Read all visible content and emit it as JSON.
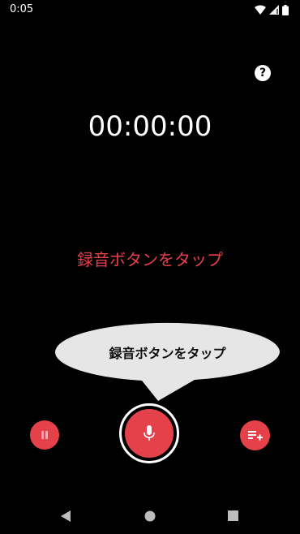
{
  "status_bar": {
    "time": "0:05",
    "icons": [
      "wifi-icon",
      "signal-icon",
      "battery-icon"
    ]
  },
  "help": {
    "icon": "help-icon",
    "label": "?"
  },
  "timer": {
    "value": "00:00:00"
  },
  "hint": {
    "text": "録音ボタンをタップ",
    "color": "#e5414b"
  },
  "tooltip": {
    "text": "録音ボタンをタップ"
  },
  "controls": {
    "pause_icon": "pause-icon",
    "record_icon": "microphone-icon",
    "list_icon": "playlist-add-icon",
    "accent_color": "#e5414b"
  },
  "nav": {
    "icons": [
      "back-icon",
      "home-icon",
      "recents-icon"
    ]
  }
}
